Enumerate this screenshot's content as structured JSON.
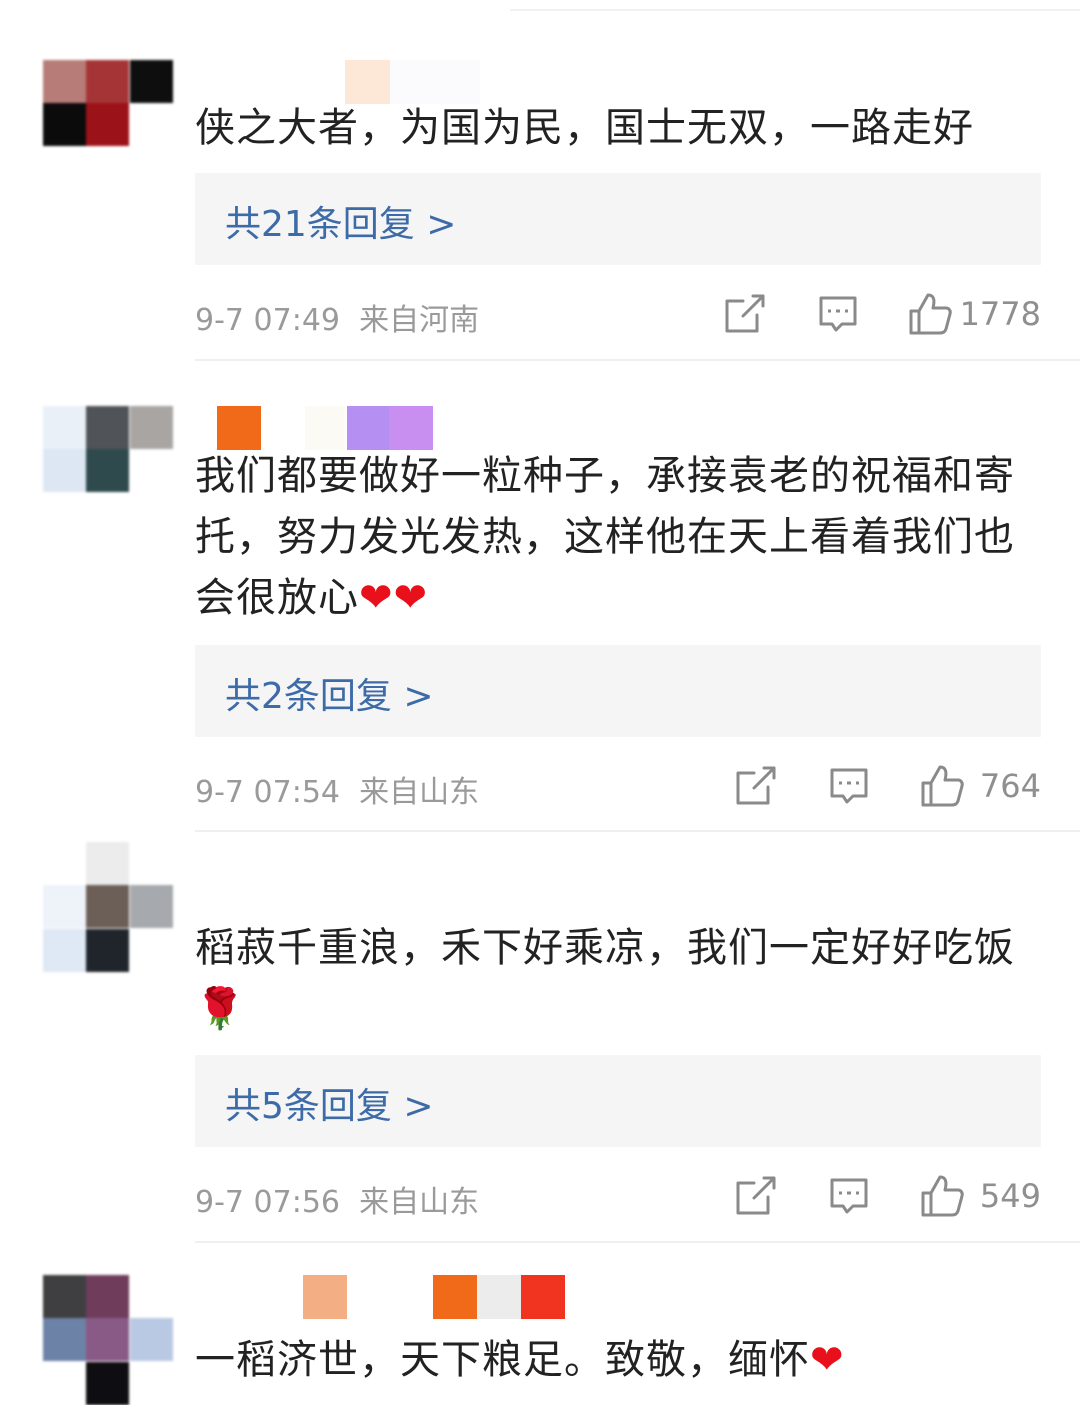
{
  "comments": [
    {
      "text": "侠之大者，为国为民，国士无双，一路走好",
      "emoji": "",
      "replies": "共21条回复 >",
      "time": "9-7 07:49",
      "location": "来自河南",
      "likes": "1778"
    },
    {
      "text": "我们都要做好一粒种子，承接袁老的祝福和寄托，努力发光发热，这样他在天上看着我们也会很放心",
      "emoji": "❤❤",
      "replies": "共2条回复 >",
      "time": "9-7 07:54",
      "location": "来自山东",
      "likes": "764"
    },
    {
      "text": "稻菽千重浪，禾下好乘凉，我们一定好好吃饭",
      "emoji": "🌹",
      "replies": "共5条回复 >",
      "time": "9-7 07:56",
      "location": "来自山东",
      "likes": "549"
    },
    {
      "text": "一稻济世，天下粮足。致敬，缅怀",
      "emoji": "❤"
    }
  ],
  "icons": {
    "share": "share-icon",
    "comment": "comment-icon",
    "like": "thumbs-up-icon"
  },
  "colors": {
    "reply_link": "#3d6ba8",
    "meta_text": "#9a9a9a",
    "heart": "#e8101a"
  }
}
